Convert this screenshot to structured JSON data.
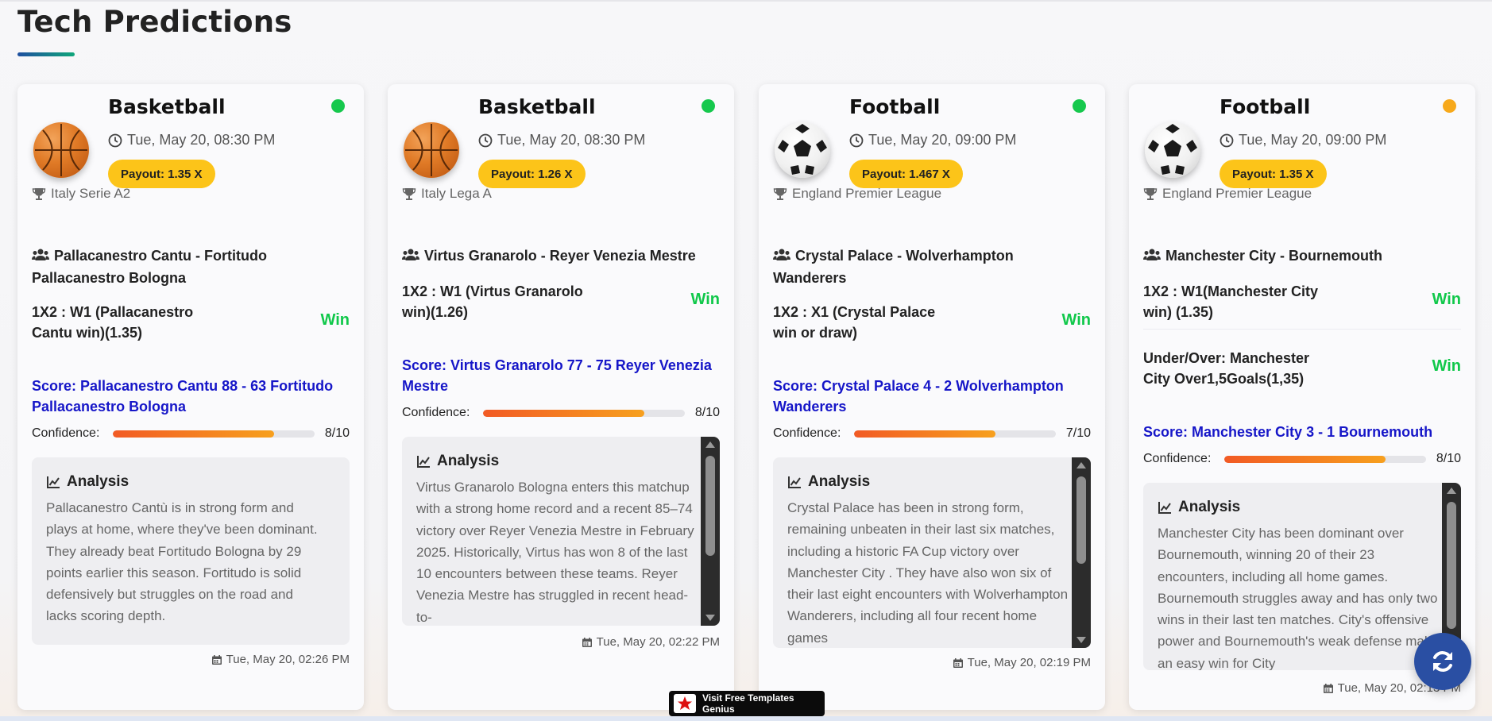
{
  "page": {
    "title": "Tech Predictions"
  },
  "colors": {
    "status_green": "#16c84d",
    "status_amber": "#f7a91b",
    "payout_yellow": "#fcc419",
    "win_green": "#10c84a",
    "score_blue": "#1616c8",
    "refresh_blue": "#2a4fa3"
  },
  "cards": [
    {
      "sport": "Basketball",
      "sport_icon": "basketball-icon",
      "status": "green",
      "time": "Tue, May 20, 08:30 PM",
      "payout": "Payout: 1.35 X",
      "league": "Italy Serie A2",
      "teams": "Pallacanestro Cantu - Fortitudo Pallacanestro Bologna",
      "bets": [
        {
          "text": "1X2 : W1 (Pallacanestro Cantu win)(1.35)",
          "result": "Win"
        }
      ],
      "score": "Score: Pallacanestro Cantu 88 - 63 Fortitudo Pallacanestro Bologna",
      "confidence_label": "Confidence:",
      "confidence": "8/10",
      "confidence_fraction": 0.8,
      "analysis_title": "Analysis",
      "analysis": "Pallacanestro Cantù is in strong form and plays at home, where they've been dominant. They already beat Fortitudo Bologna by 29 points earlier this season. Fortitudo is solid defensively but struggles on the road and lacks scoring depth.",
      "posted": "Tue, May 20, 02:26 PM"
    },
    {
      "sport": "Basketball",
      "sport_icon": "basketball-icon",
      "status": "green",
      "time": "Tue, May 20, 08:30 PM",
      "payout": "Payout: 1.26 X",
      "league": "Italy Lega A",
      "teams": "Virtus Granarolo - Reyer Venezia Mestre",
      "bets": [
        {
          "text": "1X2 : W1 (Virtus Granarolo win)(1.26)",
          "result": "Win"
        }
      ],
      "score": "Score: Virtus Granarolo 77 - 75 Reyer Venezia Mestre",
      "confidence_label": "Confidence:",
      "confidence": "8/10",
      "confidence_fraction": 0.8,
      "analysis_title": "Analysis",
      "analysis": "Virtus Granarolo Bologna enters this matchup with a strong home record and a recent 85–74 victory over Reyer Venezia Mestre in February 2025. Historically, Virtus has won 8 of the last 10 encounters between these teams. Reyer Venezia Mestre has struggled in recent head-to-",
      "posted": "Tue, May 20, 02:22 PM"
    },
    {
      "sport": "Football",
      "sport_icon": "soccer-ball-icon",
      "status": "green",
      "time": "Tue, May 20, 09:00 PM",
      "payout": "Payout: 1.467 X",
      "league": "England Premier League",
      "teams": "Crystal Palace - Wolverhampton Wanderers",
      "bets": [
        {
          "text": "1X2 : X1 (Crystal Palace win or draw)",
          "result": "Win"
        }
      ],
      "score": "Score: Crystal Palace 4 - 2 Wolverhampton Wanderers",
      "confidence_label": "Confidence:",
      "confidence": "7/10",
      "confidence_fraction": 0.7,
      "analysis_title": "Analysis",
      "analysis": "Crystal Palace has been in strong form, remaining unbeaten in their last six matches, including a historic FA Cup victory over Manchester City . They have also won six of their last eight encounters with Wolverhampton Wanderers, including all four recent home games",
      "posted": "Tue, May 20, 02:19 PM"
    },
    {
      "sport": "Football",
      "sport_icon": "soccer-ball-icon",
      "status": "amber",
      "time": "Tue, May 20, 09:00 PM",
      "payout": "Payout: 1.35 X",
      "league": "England Premier League",
      "teams": "Manchester City - Bournemouth",
      "bets": [
        {
          "text": "1X2 : W1(Manchester City win) (1.35)",
          "result": "Win"
        },
        {
          "text": "Under/Over: Manchester City Over1,5Goals(1,35)",
          "result": "Win"
        }
      ],
      "score": "Score: Manchester City 3 - 1 Bournemouth",
      "confidence_label": "Confidence:",
      "confidence": "8/10",
      "confidence_fraction": 0.8,
      "analysis_title": "Analysis",
      "analysis": "Manchester City has been dominant over Bournemouth, winning 20 of their 23 encounters, including all home games. Bournemouth struggles away and has only two wins in their last ten matches. City's offensive power and Bournemouth's weak defense make an easy win for City",
      "posted": "Tue, May 20, 02:13 PM"
    }
  ],
  "promo": {
    "label": "Visit Free Templates Genius"
  },
  "refresh_icon": "refresh-icon"
}
